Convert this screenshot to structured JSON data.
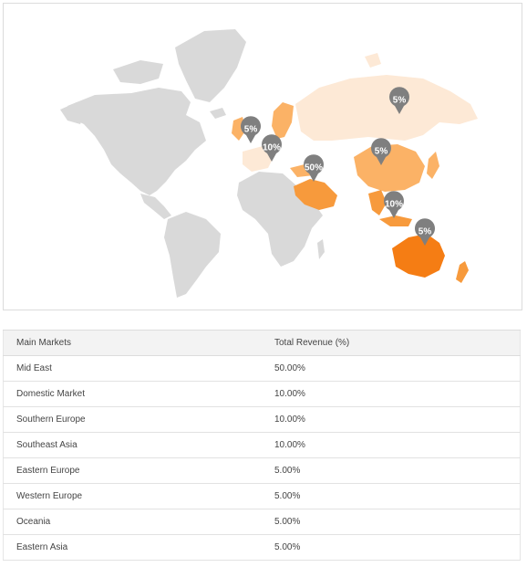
{
  "map": {
    "colors": {
      "land": "#d9d9d9",
      "tier_light": "#fde9d6",
      "tier_medium": "#fbb266",
      "tier_strong": "#f79a3c",
      "tier_max": "#f57d14",
      "pin": "#7f7f7f"
    },
    "pins": [
      {
        "region": "Western Europe",
        "label": "5%"
      },
      {
        "region": "Southern Europe",
        "label": "10%"
      },
      {
        "region": "Mid East",
        "label": "50%"
      },
      {
        "region": "Eastern Europe",
        "label": "5%"
      },
      {
        "region": "Eastern Asia",
        "label": "5%"
      },
      {
        "region": "Southeast Asia",
        "label": "10%"
      },
      {
        "region": "Oceania",
        "label": "5%"
      }
    ]
  },
  "table": {
    "headers": [
      "Main Markets",
      "Total Revenue (%)"
    ],
    "rows": [
      {
        "market": "Mid East",
        "revenue": "50.00%"
      },
      {
        "market": "Domestic Market",
        "revenue": "10.00%"
      },
      {
        "market": "Southern Europe",
        "revenue": "10.00%"
      },
      {
        "market": "Southeast Asia",
        "revenue": "10.00%"
      },
      {
        "market": "Eastern Europe",
        "revenue": "5.00%"
      },
      {
        "market": "Western Europe",
        "revenue": "5.00%"
      },
      {
        "market": "Oceania",
        "revenue": "5.00%"
      },
      {
        "market": "Eastern Asia",
        "revenue": "5.00%"
      }
    ]
  }
}
